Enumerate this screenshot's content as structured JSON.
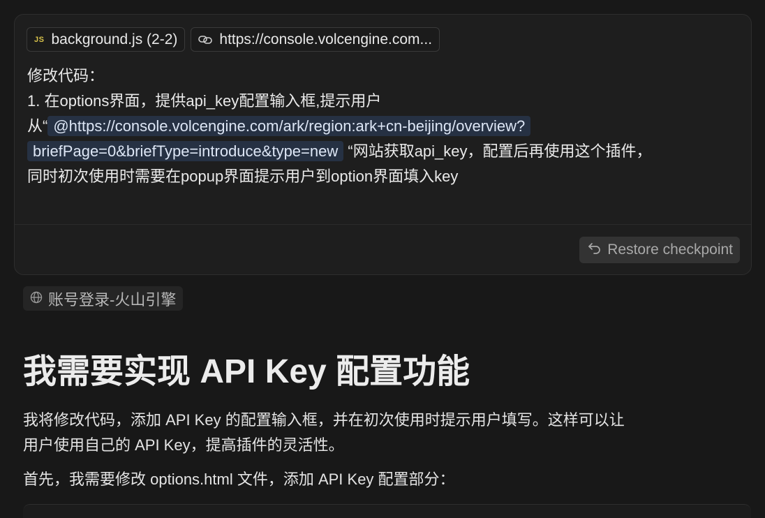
{
  "context_chips": {
    "file": {
      "icon": "JS",
      "label": "background.js (2-2)"
    },
    "link": {
      "label": "https://console.volcengine.com..."
    }
  },
  "user_message": {
    "line1": "修改代码：",
    "line2": "1. 在options界面，提供api_key配置输入框,提示用户",
    "line3_prefix": "从“",
    "mention_part1": "@https://console.volcengine.com/ark/region:ark+cn-beijing/overview?",
    "mention_part2": "briefPage=0&briefType=introduce&type=new",
    "line4_suffix": "“网站获取api_key，配置后再使用这个插件，",
    "line5": "同时初次使用时需要在popup界面提示用户到option界面填入key"
  },
  "restore_button": {
    "label": "Restore checkpoint"
  },
  "source_chip": {
    "label": "账号登录-火山引擎"
  },
  "response": {
    "heading": "我需要实现 API Key 配置功能",
    "paragraph1_line1": "我将修改代码，添加 API Key 的配置输入框，并在初次使用时提示用户填写。这样可以让",
    "paragraph1_line2": "用户使用自己的 API Key，提高插件的灵活性。",
    "paragraph2": "首先，我需要修改 options.html 文件，添加 API Key 配置部分："
  }
}
